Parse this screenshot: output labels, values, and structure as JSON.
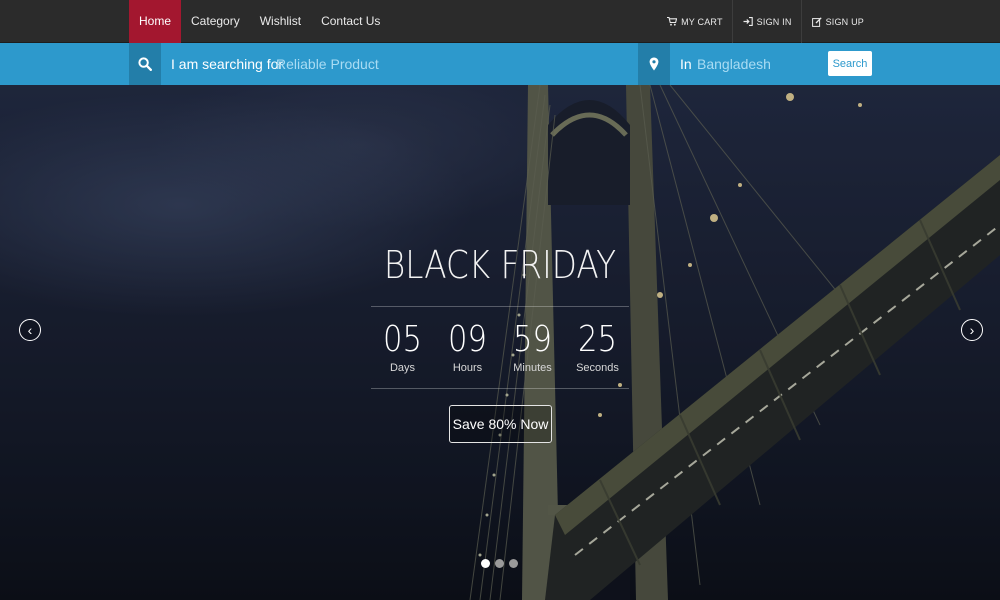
{
  "nav": {
    "left_items": [
      {
        "label": "Home",
        "active": true
      },
      {
        "label": "Category",
        "active": false
      },
      {
        "label": "Wishlist",
        "active": false
      },
      {
        "label": "Contact Us",
        "active": false
      }
    ],
    "right_items": [
      {
        "label": "MY CART",
        "icon": "cart-icon"
      },
      {
        "label": "SIGN IN",
        "icon": "sign-in-icon"
      },
      {
        "label": "SIGN UP",
        "icon": "edit-icon"
      }
    ],
    "active_color": "#a3172f",
    "background": "#2b2b2b"
  },
  "search": {
    "label": "I am searching for",
    "placeholder": "Reliable Product",
    "location_label": "In",
    "location_placeholder": "Bangladesh",
    "button_label": "Search",
    "bar_color": "#2d99cc",
    "icon": "search-icon",
    "location_icon": "map-marker-icon"
  },
  "hero": {
    "title": "BLACK FRIDAY",
    "countdown": [
      {
        "value": "05",
        "label": "Days"
      },
      {
        "value": "09",
        "label": "Hours"
      },
      {
        "value": "59",
        "label": "Minutes"
      },
      {
        "value": "25",
        "label": "Seconds"
      }
    ],
    "cta_label": "Save 80% Now",
    "prev_glyph": "‹",
    "next_glyph": "›",
    "slides_count": 3,
    "active_slide": 1
  }
}
